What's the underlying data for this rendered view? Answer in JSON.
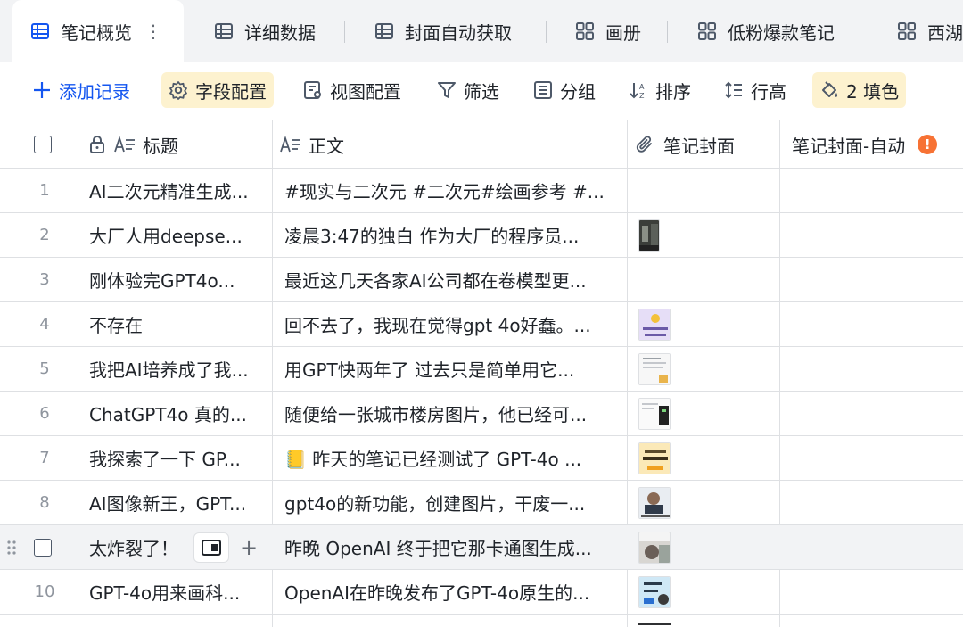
{
  "tabs": [
    {
      "label": "笔记概览",
      "icon": "grid-table-icon"
    },
    {
      "label": "详细数据",
      "icon": "grid-table-icon"
    },
    {
      "label": "封面自动获取",
      "icon": "grid-table-icon"
    },
    {
      "label": "画册",
      "icon": "gallery-icon"
    },
    {
      "label": "低粉爆款笔记",
      "icon": "gallery-icon"
    },
    {
      "label": "西湖",
      "icon": "gallery-icon"
    }
  ],
  "toolbar": {
    "add": "添加记录",
    "fields": "字段配置",
    "view": "视图配置",
    "filter": "筛选",
    "group": "分组",
    "sort": "排序",
    "row_height": "行高",
    "fill": "2 填色"
  },
  "columns": {
    "title": "标题",
    "body": "正文",
    "cover": "笔记封面",
    "cover_auto": "笔记封面-自动",
    "warn_glyph": "!"
  },
  "rows": [
    {
      "num": "1",
      "title": "AI二次元精准生成...",
      "body": "#现实与二次元 #二次元#绘画参考 #...",
      "cover": ""
    },
    {
      "num": "2",
      "title": "大厂人用deepse...",
      "body": "凌晨3:47的独白 作为大厂的程序员...",
      "cover": "dark-photo"
    },
    {
      "num": "3",
      "title": "刚体验完GPT4o...",
      "body": "最近这几天各家AI公司都在卷模型更...",
      "cover": ""
    },
    {
      "num": "4",
      "title": "不存在",
      "body": "回不去了，我现在觉得gpt 4o好蠢。...",
      "cover": "purple-card"
    },
    {
      "num": "5",
      "title": "我把AI培养成了我...",
      "body": "用GPT快两年了 过去只是简单用它...",
      "cover": "white-doc"
    },
    {
      "num": "6",
      "title": "ChatGPT4o 真的...",
      "body": "随便给一张城市楼房图片，他已经可...",
      "cover": "screen-doc"
    },
    {
      "num": "7",
      "title": "我探索了一下 GP...",
      "body": "📒 昨天的笔记已经测试了 GPT-4o ...",
      "cover": "yellow-card"
    },
    {
      "num": "8",
      "title": "AI图像新王，GPT...",
      "body": "gpt4o的新功能，创建图片，干废一...",
      "cover": "portrait"
    },
    {
      "num": "",
      "title": "太炸裂了！",
      "body": "昨晚 OpenAI 终于把它那卡通图生成...",
      "cover": "street-photo"
    },
    {
      "num": "10",
      "title": "GPT-4o用来画科...",
      "body": "OpenAI在昨晚发布了GPT-4o原生的...",
      "cover": "blue-card"
    }
  ],
  "colors": {
    "accent": "#1456f0",
    "highlight": "#fdf2cf",
    "warn": "#f77234"
  }
}
